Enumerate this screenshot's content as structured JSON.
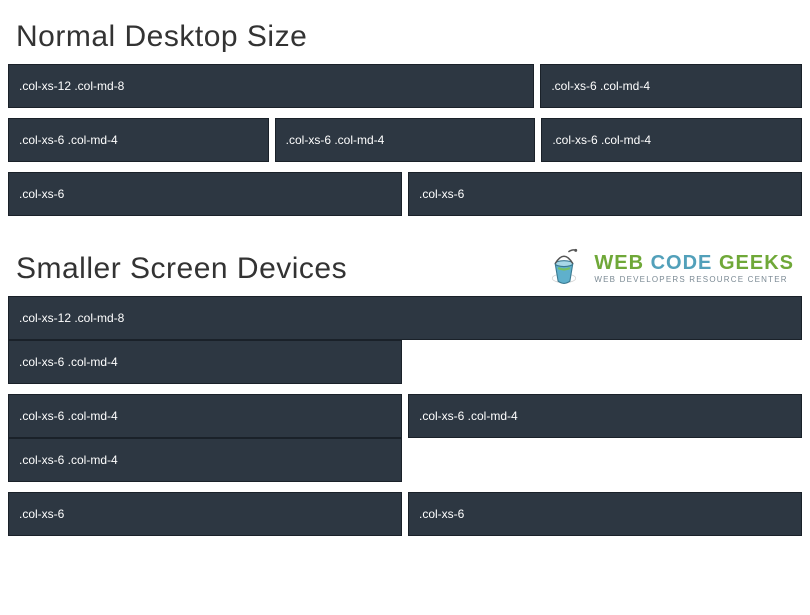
{
  "headings": {
    "desktop": "Normal Desktop Size",
    "smaller": "Smaller Screen Devices"
  },
  "desktop_rows": {
    "row1": [
      ".col-xs-12 .col-md-8",
      ".col-xs-6 .col-md-4"
    ],
    "row2": [
      ".col-xs-6 .col-md-4",
      ".col-xs-6 .col-md-4",
      ".col-xs-6 .col-md-4"
    ],
    "row3": [
      ".col-xs-6",
      ".col-xs-6"
    ]
  },
  "smaller_rows": {
    "row1": [
      ".col-xs-12 .col-md-8"
    ],
    "row2": [
      ".col-xs-6 .col-md-4"
    ],
    "row3": [
      ".col-xs-6 .col-md-4",
      ".col-xs-6 .col-md-4"
    ],
    "row4": [
      ".col-xs-6 .col-md-4"
    ],
    "row5": [
      ".col-xs-6",
      ".col-xs-6"
    ]
  },
  "logo": {
    "main": "WEB CODE GEEKS",
    "sub": "WEB DEVELOPERS RESOURCE CENTER"
  }
}
